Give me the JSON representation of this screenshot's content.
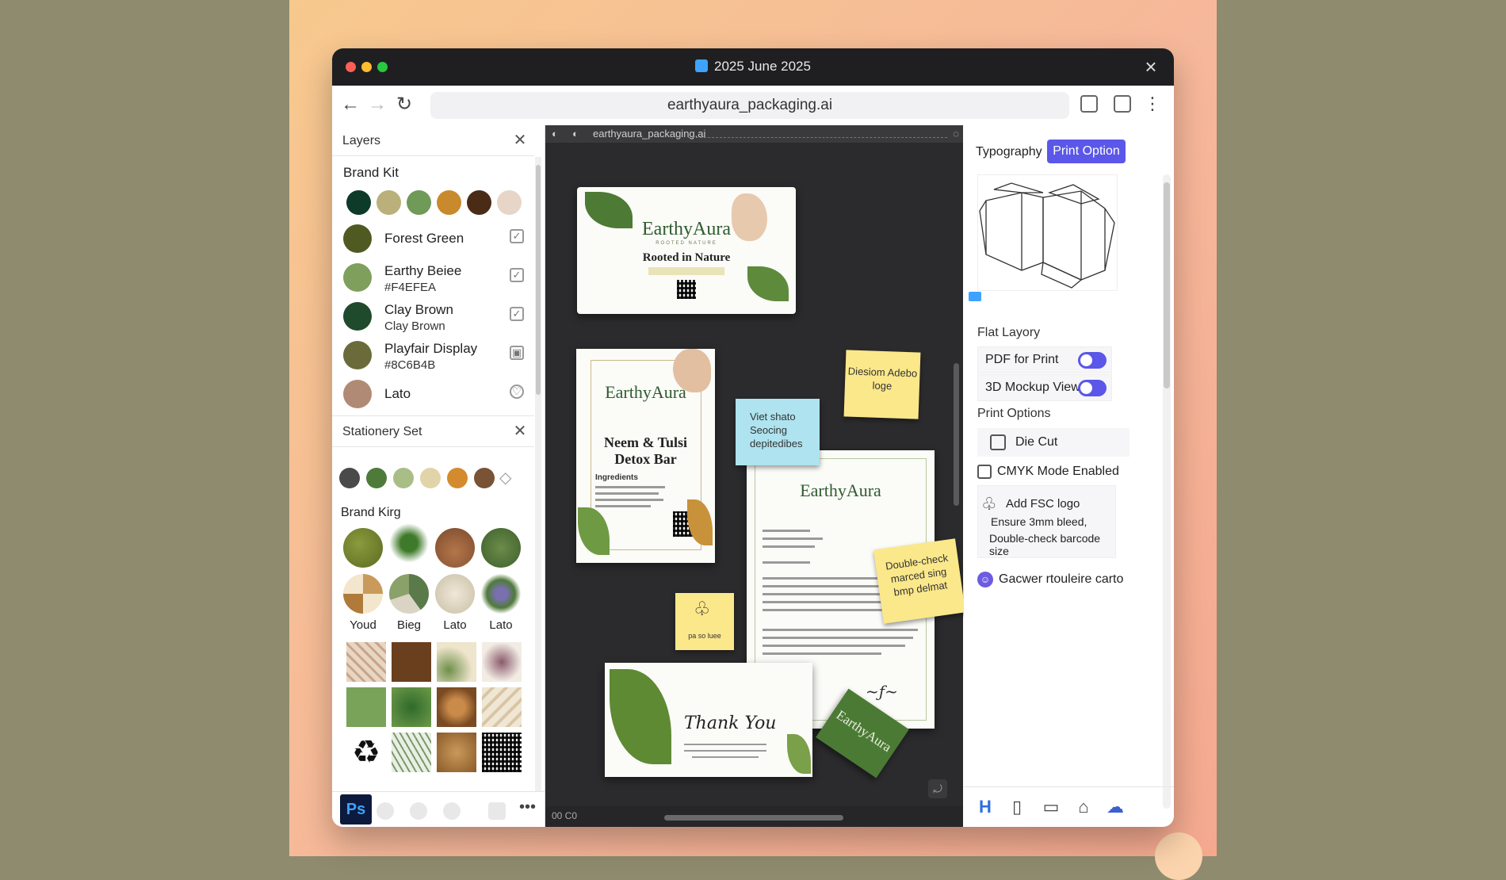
{
  "window": {
    "title": "2025 June 2025"
  },
  "browser": {
    "url": "earthyaura_packaging.ai"
  },
  "layers": {
    "title": "Layers",
    "brand_kit": {
      "title": "Brand Kit",
      "swatches": [
        "#0e3a2a",
        "#b9b07a",
        "#6f9a58",
        "#c88a2c",
        "#4a2c16",
        "#e7d6c7"
      ],
      "items": [
        {
          "name": "Forest Green",
          "sub": "",
          "color": "#4f5a22"
        },
        {
          "name": "Earthy Beiee",
          "sub": "#F4EFEA",
          "color": "#7fa05c"
        },
        {
          "name": "Clay Brown",
          "sub": "Clay Brown",
          "color": "#1f4a2b"
        },
        {
          "name": "Playfair Display",
          "sub": "#8C6B4B",
          "color": "#6b6a3a"
        },
        {
          "name": "Lato",
          "sub": "",
          "color": "#b08a74"
        }
      ]
    },
    "stationery": {
      "title": "Stationery Set",
      "swatches": [
        "#4a4a4a",
        "#4e7b3a",
        "#a9be86",
        "#e2d4a8",
        "#d38b2e",
        "#7a5235"
      ],
      "kit_title": "Brand Kirg",
      "leaves": [
        "Youd",
        "Bieg",
        "Lato",
        "Lato"
      ]
    },
    "footer": {
      "ps": "Ps"
    }
  },
  "canvas": {
    "tab": "earthyaura_packaging.ai",
    "zoom": "00  C0",
    "packaging": {
      "brand": "EarthyAura",
      "tagline": "Rooted in Nature",
      "mini": "ROOTED NATURE"
    },
    "soap_box": {
      "brand": "EarthyAura",
      "product": "Neem & Tulsi Detox Bar",
      "ingredients": "Ingredients"
    },
    "letterhead": {
      "brand": "EarthyAura"
    },
    "thank_you": {
      "text": "Thank You"
    },
    "business_card": {
      "brand": "EarthyAura"
    },
    "sticky_notes": [
      {
        "text": "Diesiom Adebo loge",
        "color": "#fbe88a"
      },
      {
        "text": "Viet shato Seocing depitedibes",
        "color": "#aee3ef"
      },
      {
        "text": "Double-check marced sing bmp delmat",
        "color": "#fbe88a"
      },
      {
        "text": "pa so luee",
        "color": "#fbe88a"
      }
    ]
  },
  "right_panel": {
    "tabs": {
      "typography": "Typography",
      "print": "Print Option"
    },
    "flat_layout_label": "Flat Layory",
    "toggles": [
      {
        "label": "PDF for Print",
        "on": true
      },
      {
        "label": "3D Mockup View",
        "on": true
      }
    ],
    "print_options_label": "Print Options",
    "die_cut": "Die Cut",
    "cmyk": "CMYK Mode Enabled",
    "notes": {
      "title": "Add FSC logo",
      "line1": "Ensure 3mm bleed,",
      "line2": "Double-check barcode size"
    },
    "collab": "Gacwer rtouleire carto"
  }
}
